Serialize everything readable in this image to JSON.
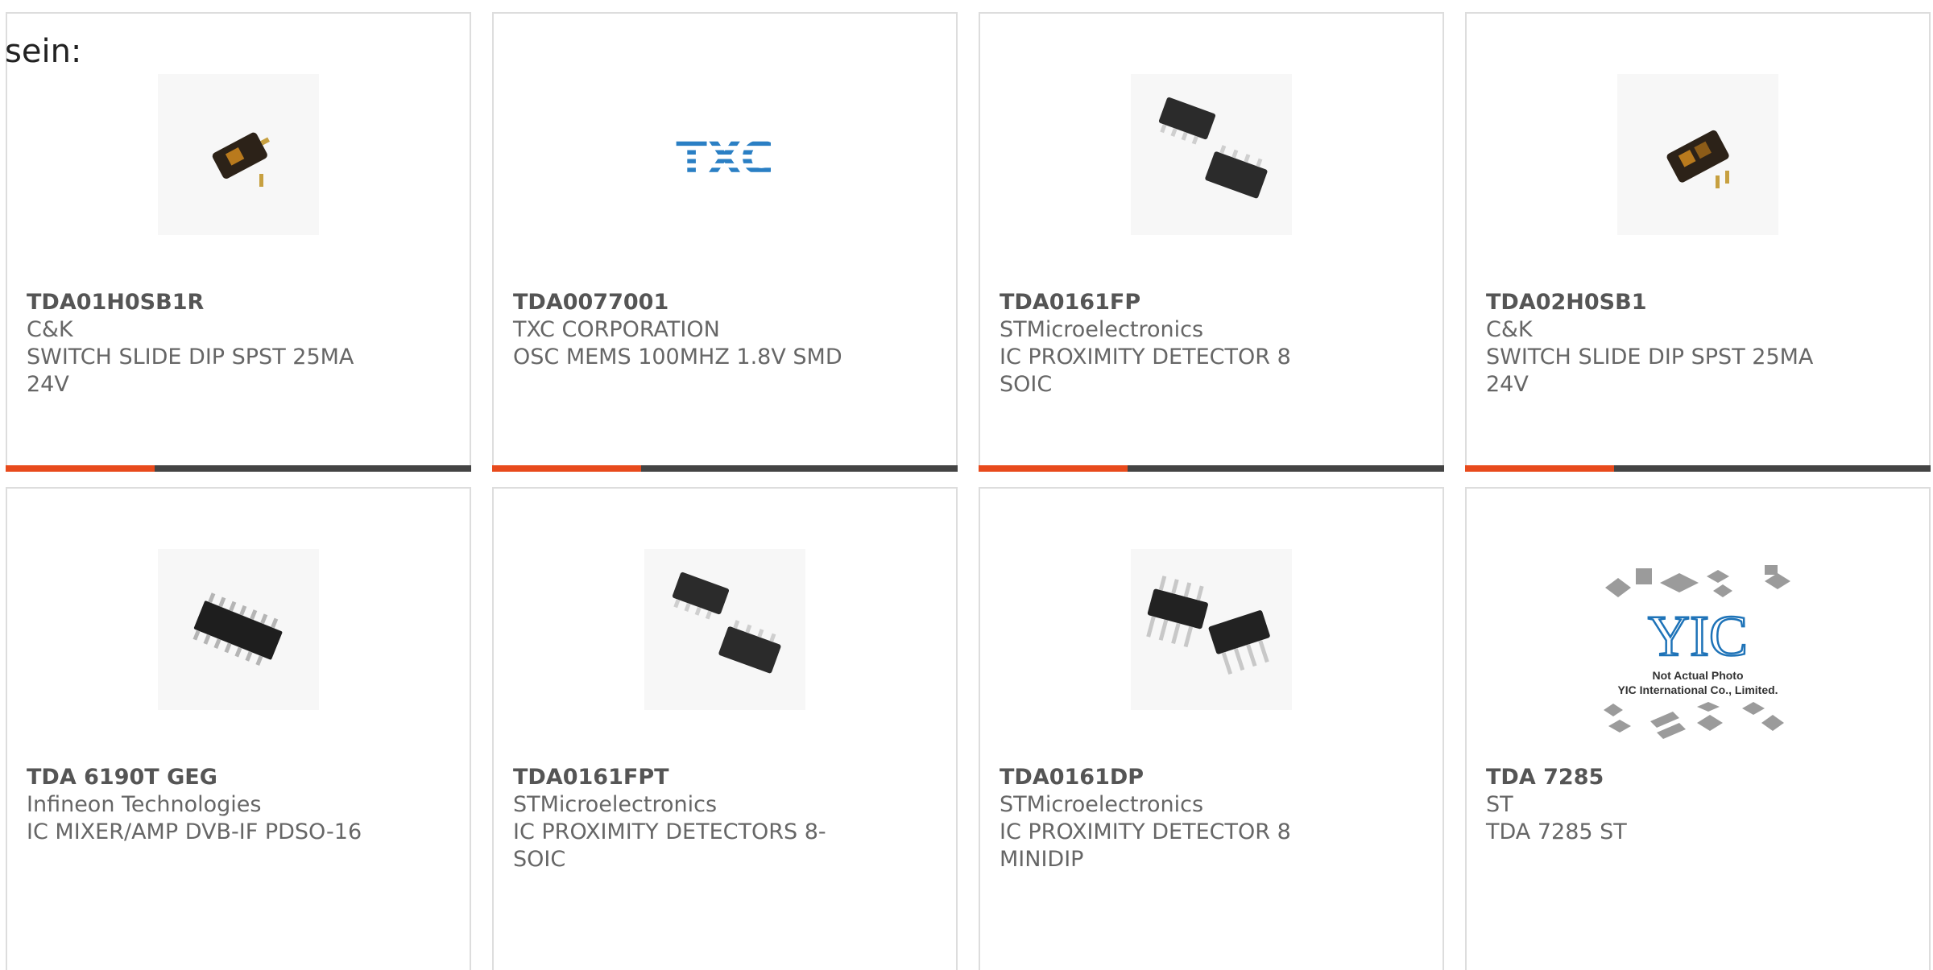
{
  "intro_text": "sein:",
  "colors": {
    "accent": "#e84a1c",
    "bar_track": "#444444",
    "border": "#dddddd"
  },
  "products": [
    {
      "part_number": "TDA01H0SB1R",
      "manufacturer": "C&K",
      "description": "SWITCH SLIDE DIP SPST 25MA 24V",
      "image": "dip-switch-1-position"
    },
    {
      "part_number": "TDA0077001",
      "manufacturer": "TXC CORPORATION",
      "description": "OSC MEMS 100MHZ 1.8V SMD",
      "image": "txc-logo",
      "logo_text": "TXC"
    },
    {
      "part_number": "TDA0161FP",
      "manufacturer": "STMicroelectronics",
      "description": "IC PROXIMITY DETECTOR 8 SOIC",
      "image": "soic-8-chips"
    },
    {
      "part_number": "TDA02H0SB1",
      "manufacturer": "C&K",
      "description": "SWITCH SLIDE DIP SPST 25MA 24V",
      "image": "dip-switch-2-position"
    },
    {
      "part_number": "TDA 6190T GEG",
      "manufacturer": "Infineon Technologies",
      "description": "IC MIXER/AMP DVB-IF PDSO-16",
      "image": "pdso-16-chip"
    },
    {
      "part_number": "TDA0161FPT",
      "manufacturer": "STMicroelectronics",
      "description": "IC PROXIMITY DETECTORS 8-SOIC",
      "image": "soic-8-chips"
    },
    {
      "part_number": "TDA0161DP",
      "manufacturer": "STMicroelectronics",
      "description": "IC PROXIMITY DETECTOR 8 MINIDIP",
      "image": "dip-8-chips"
    },
    {
      "part_number": "TDA 7285",
      "manufacturer": "ST",
      "description": "TDA 7285 ST",
      "image": "yic-placeholder",
      "placeholder_logo": "YIC",
      "placeholder_line1": "Not Actual Photo",
      "placeholder_line2": "YIC International Co., Limited."
    }
  ],
  "card_bars": [
    {
      "progress_fraction": 0.32
    },
    {
      "progress_fraction": 0.32
    },
    {
      "progress_fraction": 0.32
    },
    {
      "progress_fraction": 0.32
    }
  ]
}
